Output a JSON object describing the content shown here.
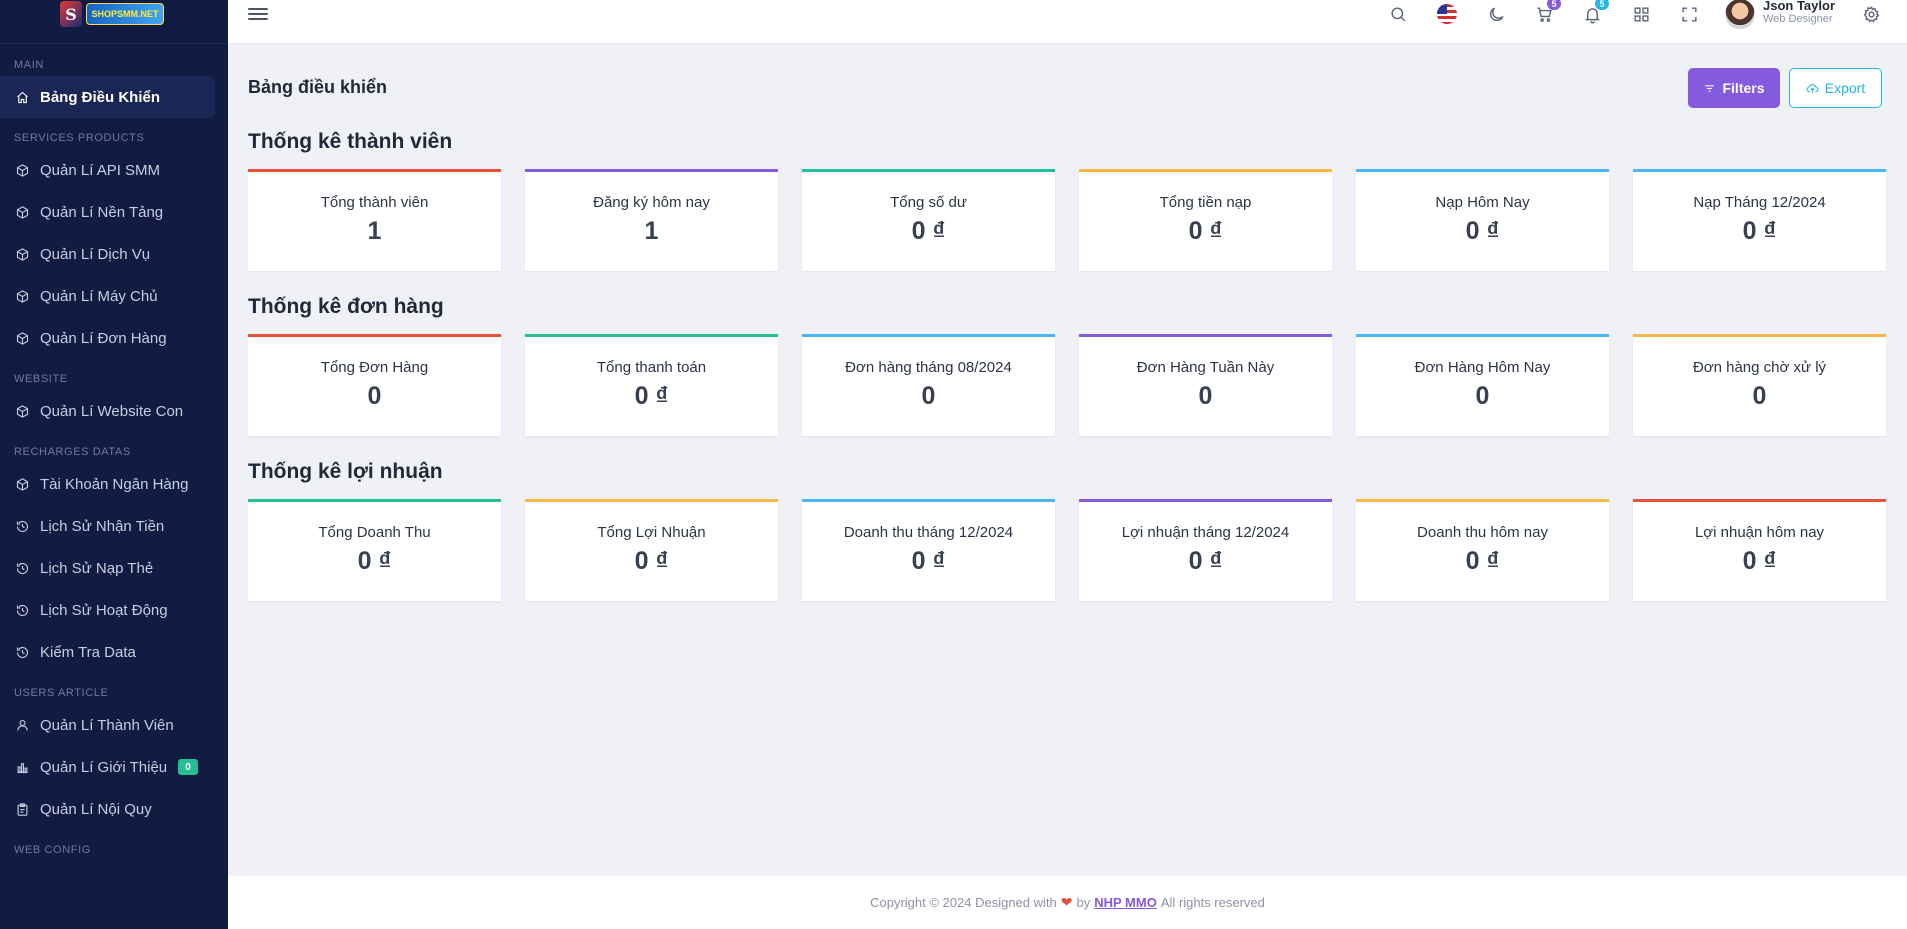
{
  "sidebar": {
    "logo_text": "SHOPSMM.NET",
    "sections": [
      {
        "title": "MAIN",
        "items": [
          {
            "label": "Bảng Điều Khiển",
            "icon": "home-icon",
            "active": true
          }
        ]
      },
      {
        "title": "SERVICES PRODUCTS",
        "items": [
          {
            "label": "Quản Lí API SMM",
            "icon": "box-icon"
          },
          {
            "label": "Quản Lí Nền Tảng",
            "icon": "box-icon"
          },
          {
            "label": "Quản Lí Dịch Vụ",
            "icon": "box-icon"
          },
          {
            "label": "Quản Lí Máy Chủ",
            "icon": "box-icon"
          },
          {
            "label": "Quản Lí Đơn Hàng",
            "icon": "box-icon"
          }
        ]
      },
      {
        "title": "WEBSITE",
        "items": [
          {
            "label": "Quản Lí Website Con",
            "icon": "box-icon"
          }
        ]
      },
      {
        "title": "RECHARGES DATAS",
        "items": [
          {
            "label": "Tài Khoản Ngân Hàng",
            "icon": "box-icon"
          },
          {
            "label": "Lịch Sử Nhận Tiền",
            "icon": "history-icon"
          },
          {
            "label": "Lịch Sử Nạp Thẻ",
            "icon": "history-icon"
          },
          {
            "label": "Lịch Sử Hoạt Động",
            "icon": "history-icon"
          },
          {
            "label": "Kiểm Tra Data",
            "icon": "history-icon"
          }
        ]
      },
      {
        "title": "USERS ARTICLE",
        "items": [
          {
            "label": "Quản Lí Thành Viên",
            "icon": "user-icon"
          },
          {
            "label": "Quản Lí Giới Thiệu",
            "icon": "bar-chart-icon",
            "badge": "0"
          },
          {
            "label": "Quản Lí Nội Quy",
            "icon": "clipboard-icon"
          }
        ]
      },
      {
        "title": "WEB CONFIG",
        "items": []
      }
    ]
  },
  "header": {
    "cart_badge": "5",
    "notification_badge": "5",
    "user_name": "Json Taylor",
    "user_role": "Web Designer",
    "colors": {
      "cart_badge": "#845adf",
      "notification_badge": "#23b7e5"
    }
  },
  "page": {
    "title": "Bảng điều khiển",
    "filters_label": "Filters",
    "export_label": "Export"
  },
  "stats": [
    {
      "title": "Thống kê thành viên",
      "cards": [
        {
          "label": "Tổng thành viên",
          "value": "1",
          "color": "#e5533b"
        },
        {
          "label": "Đăng ký hôm nay",
          "value": "1",
          "color": "#845adf"
        },
        {
          "label": "Tổng số dư",
          "value": "0 ₫",
          "color": "#26bf94"
        },
        {
          "label": "Tổng tiền nạp",
          "value": "0 ₫",
          "color": "#f5b849"
        },
        {
          "label": "Nạp Hôm Nay",
          "value": "0 ₫",
          "color": "#49b6f5"
        },
        {
          "label": "Nạp Tháng 12/2024",
          "value": "0 ₫",
          "color": "#49b6f5"
        }
      ]
    },
    {
      "title": "Thống kê đơn hàng",
      "cards": [
        {
          "label": "Tổng Đơn Hàng",
          "value": "0",
          "color": "#e5533b"
        },
        {
          "label": "Tổng thanh toán",
          "value": "0 ₫",
          "color": "#26bf94"
        },
        {
          "label": "Đơn hàng tháng 08/2024",
          "value": "0",
          "color": "#49b6f5"
        },
        {
          "label": "Đơn Hàng Tuần Này",
          "value": "0",
          "color": "#845adf"
        },
        {
          "label": "Đơn Hàng Hôm Nay",
          "value": "0",
          "color": "#49b6f5"
        },
        {
          "label": "Đơn hàng chờ xử lý",
          "value": "0",
          "color": "#f5b849"
        }
      ]
    },
    {
      "title": "Thống kê lợi nhuận",
      "cards": [
        {
          "label": "Tổng Doanh Thu",
          "value": "0 ₫",
          "color": "#26bf94"
        },
        {
          "label": "Tổng Lợi Nhuận",
          "value": "0 ₫",
          "color": "#f5b849"
        },
        {
          "label": "Doanh thu tháng 12/2024",
          "value": "0 ₫",
          "color": "#49b6f5"
        },
        {
          "label": "Lợi nhuận tháng 12/2024",
          "value": "0 ₫",
          "color": "#845adf"
        },
        {
          "label": "Doanh thu hôm nay",
          "value": "0 ₫",
          "color": "#f5b849"
        },
        {
          "label": "Lợi nhuận hôm nay",
          "value": "0 ₫",
          "color": "#e5533b"
        }
      ]
    }
  ],
  "footer": {
    "text_before": "Copyright © 2024 Designed with",
    "by": "by",
    "link": "NHP MMO",
    "text_after": "All rights reserved"
  }
}
